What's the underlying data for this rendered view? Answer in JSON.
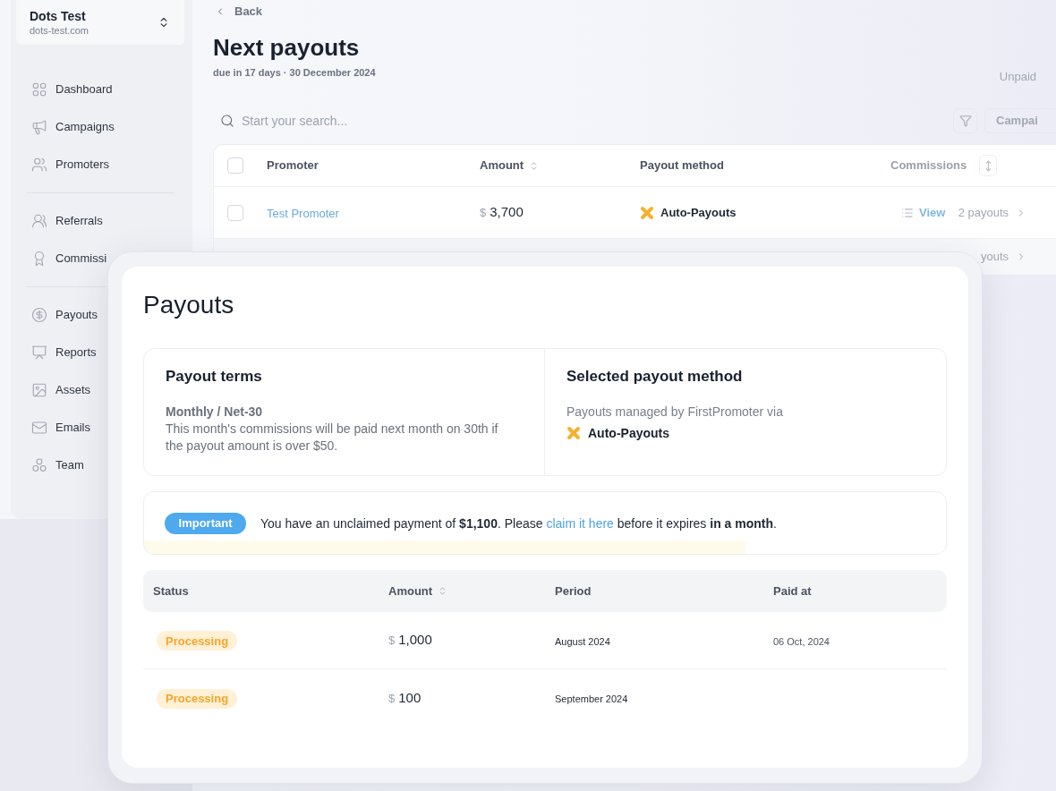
{
  "sidebar": {
    "workspace": {
      "name": "Dots Test",
      "domain": "dots-test.com"
    },
    "nav_groups": [
      {
        "items": [
          "Dashboard",
          "Campaigns",
          "Promoters"
        ]
      },
      {
        "items": [
          "Referrals",
          "Commissi"
        ]
      },
      {
        "items": [
          "Payouts",
          "Reports",
          "Assets",
          "Emails",
          "Team"
        ]
      }
    ]
  },
  "header": {
    "back": "Back",
    "title": "Next payouts",
    "subtitle": "due in 17 days · 30 December 2024",
    "status_tab": "Unpaid"
  },
  "toolbar": {
    "search": {
      "placeholder": "Start your search..."
    },
    "campaign_filter": "Campai"
  },
  "table": {
    "header_checkbox": {
      "checked": false
    },
    "columns": [
      {
        "label": "Promoter",
        "sortable": false
      },
      {
        "label": "Amount",
        "sortable": true
      },
      {
        "label": "Payout method",
        "sortable": false
      },
      {
        "label": "Commissions",
        "sortable": false
      }
    ],
    "rows": [
      {
        "checked": false,
        "promoter": "Test Promoter",
        "currency": "$",
        "amount": "3,700",
        "payout_method": "Auto-Payouts",
        "commissions_link": "View",
        "payouts": "2 payouts"
      },
      {
        "payouts": "youts"
      }
    ]
  },
  "payouts_card": {
    "title": "Payouts",
    "terms": {
      "heading": "Payout terms",
      "schedule": "Monthly / Net-30",
      "description": "This month's commissions will be paid next month on 30th if the payout amount is over $50."
    },
    "method": {
      "heading": "Selected payout method",
      "description": "Payouts managed by FirstPromoter via",
      "name": "Auto-Payouts"
    },
    "notice": {
      "badge": "Important",
      "text_before": "You have an unclaimed payment of **$1,100**. Please",
      "link": "claim it here",
      "text_after": "before it expires **in a month**."
    },
    "table": {
      "columns": [
        {
          "label": "Status",
          "sortable": false
        },
        {
          "label": "Amount",
          "sortable": true
        },
        {
          "label": "Period",
          "sortable": false
        },
        {
          "label": "Paid at",
          "sortable": false
        }
      ],
      "rows": [
        {
          "status": "Processing",
          "currency": "$",
          "amount": "1,000",
          "period": "August 2024",
          "paid_at": "06 Oct, 2024"
        },
        {
          "status": "Processing",
          "currency": "$",
          "amount": "100",
          "period": "September 2024"
        }
      ]
    }
  }
}
